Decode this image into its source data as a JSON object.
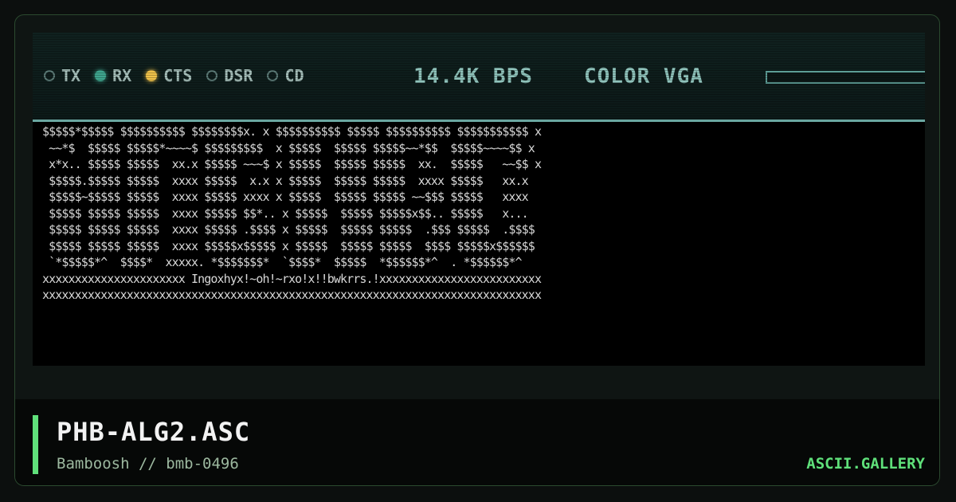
{
  "status_bar": {
    "indicators": [
      {
        "label": "TX",
        "state": "off"
      },
      {
        "label": "RX",
        "state": "on",
        "color": "#3fa58e"
      },
      {
        "label": "CTS",
        "state": "on",
        "color": "#f0c24a"
      },
      {
        "label": "DSR",
        "state": "off"
      },
      {
        "label": "CD",
        "state": "off"
      }
    ],
    "baud": "14.4K BPS",
    "mode": "COLOR VGA",
    "meter_level": 0.0
  },
  "artwork": {
    "lines": [
      "$$$$$*$$$$$ $$$$$$$$$$ $$$$$$$$x. x $$$$$$$$$$ $$$$$ $$$$$$$$$$ $$$$$$$$$$$ x",
      " ~~*$  $$$$$ $$$$$*~~~~$ $$$$$$$$$  x $$$$$  $$$$$ $$$$$~~*$$  $$$$$~~~~$$ x",
      " x*x.. $$$$$ $$$$$  xx.x $$$$$ ~~~$ x $$$$$  $$$$$ $$$$$  xx.  $$$$$   ~~$$ x",
      " $$$$$.$$$$$ $$$$$  xxxx $$$$$  x.x x $$$$$  $$$$$ $$$$$  xxxx $$$$$   xx.x",
      " $$$$$~$$$$$ $$$$$  xxxx $$$$$ xxxx x $$$$$  $$$$$ $$$$$ ~~$$$ $$$$$   xxxx",
      " $$$$$ $$$$$ $$$$$  xxxx $$$$$ $$*.. x $$$$$  $$$$$ $$$$$x$$.. $$$$$   x... ",
      " $$$$$ $$$$$ $$$$$  xxxx $$$$$ .$$$$ x $$$$$  $$$$$ $$$$$  .$$$ $$$$$  .$$$$",
      " $$$$$ $$$$$ $$$$$  xxxx $$$$$x$$$$$ x $$$$$  $$$$$ $$$$$  $$$$ $$$$$x$$$$$$",
      " `*$$$$$*^  $$$$*  xxxxx. *$$$$$$$*  `$$$$*  $$$$$  *$$$$$$*^  . *$$$$$$*^ ",
      "xxxxxxxxxxxxxxxxxxxxxx Ingoxhyx!~oh!~rxo!x!!bwkrrs.!xxxxxxxxxxxxxxxxxxxxxxxxx",
      "xxxxxxxxxxxxxxxxxxxxxxxxxxxxxxxxxxxxxxxxxxxxxxxxxxxxxxxxxxxxxxxxxxxxxxxxxxxxx"
    ]
  },
  "footer": {
    "title": "PHB-ALG2.ASC",
    "subtitle": "Bamboosh // bmb-0496",
    "brand": "ASCII.GALLERY",
    "accent_color": "#5fe07a"
  }
}
